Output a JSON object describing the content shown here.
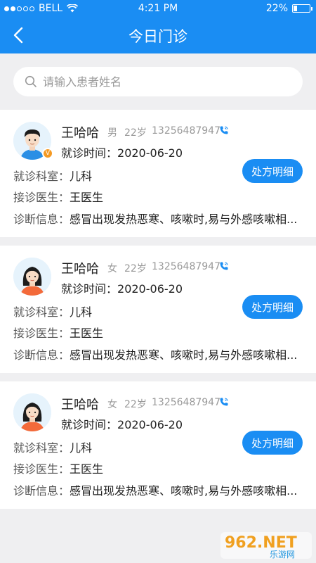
{
  "status_bar": {
    "carrier": "BELL",
    "time": "4:21 PM",
    "battery": "22%",
    "battery_level": 0.22
  },
  "nav": {
    "title": "今日门诊"
  },
  "search": {
    "placeholder": "请输入患者姓名",
    "value": ""
  },
  "labels": {
    "visit_time": "就诊时间：",
    "dept": "就诊科室：",
    "doctor": "接诊医生：",
    "diagnosis": "诊断信息：",
    "rx_button": "处方明细"
  },
  "patients": [
    {
      "name": "王哈哈",
      "gender": "男",
      "age": "22岁",
      "phone": "13256487947",
      "visit_time": "2020-06-20",
      "dept": "儿科",
      "doctor": "王医生",
      "diagnosis": "感冒出现发热恶寒、咳嗽时,易与外感咳嗽相...",
      "avatar": "male-avatar",
      "badge": "V"
    },
    {
      "name": "王哈哈",
      "gender": "女",
      "age": "22岁",
      "phone": "13256487947",
      "visit_time": "2020-06-20",
      "dept": "儿科",
      "doctor": "王医生",
      "diagnosis": "感冒出现发热恶寒、咳嗽时,易与外感咳嗽相...",
      "avatar": "female-avatar"
    },
    {
      "name": "王哈哈",
      "gender": "女",
      "age": "22岁",
      "phone": "13256487947",
      "visit_time": "2020-06-20",
      "dept": "儿科",
      "doctor": "王医生",
      "diagnosis": "感冒出现发热恶寒、咳嗽时,易与外感咳嗽相...",
      "avatar": "female-avatar"
    }
  ],
  "watermark": {
    "brand": "962.NET",
    "sub": "乐游网"
  },
  "colors": {
    "primary": "#1a8df3",
    "background": "#efeff1",
    "badge": "#f59a23"
  }
}
